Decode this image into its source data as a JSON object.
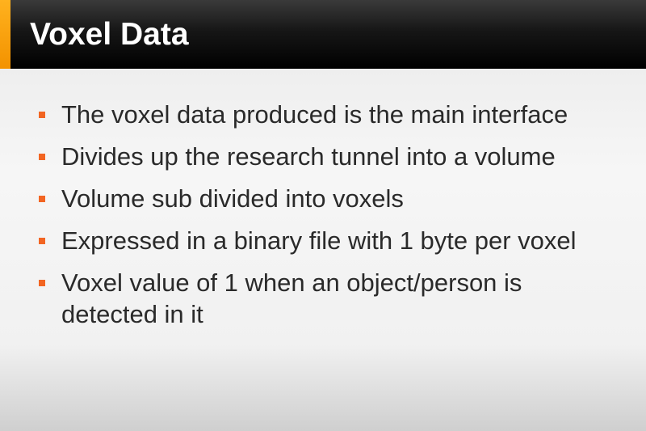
{
  "slide": {
    "title": "Voxel Data",
    "bullets": [
      "The voxel data produced is the main interface",
      "Divides up the research tunnel into a volume",
      "Volume sub divided into voxels",
      "Expressed in a binary file with 1 byte per voxel",
      "Voxel value of 1 when an object/person is detected in it"
    ]
  },
  "colors": {
    "title_bar": "#000000",
    "accent": "#f39200",
    "bullet_marker": "#f26522",
    "text": "#2a2a2a"
  }
}
